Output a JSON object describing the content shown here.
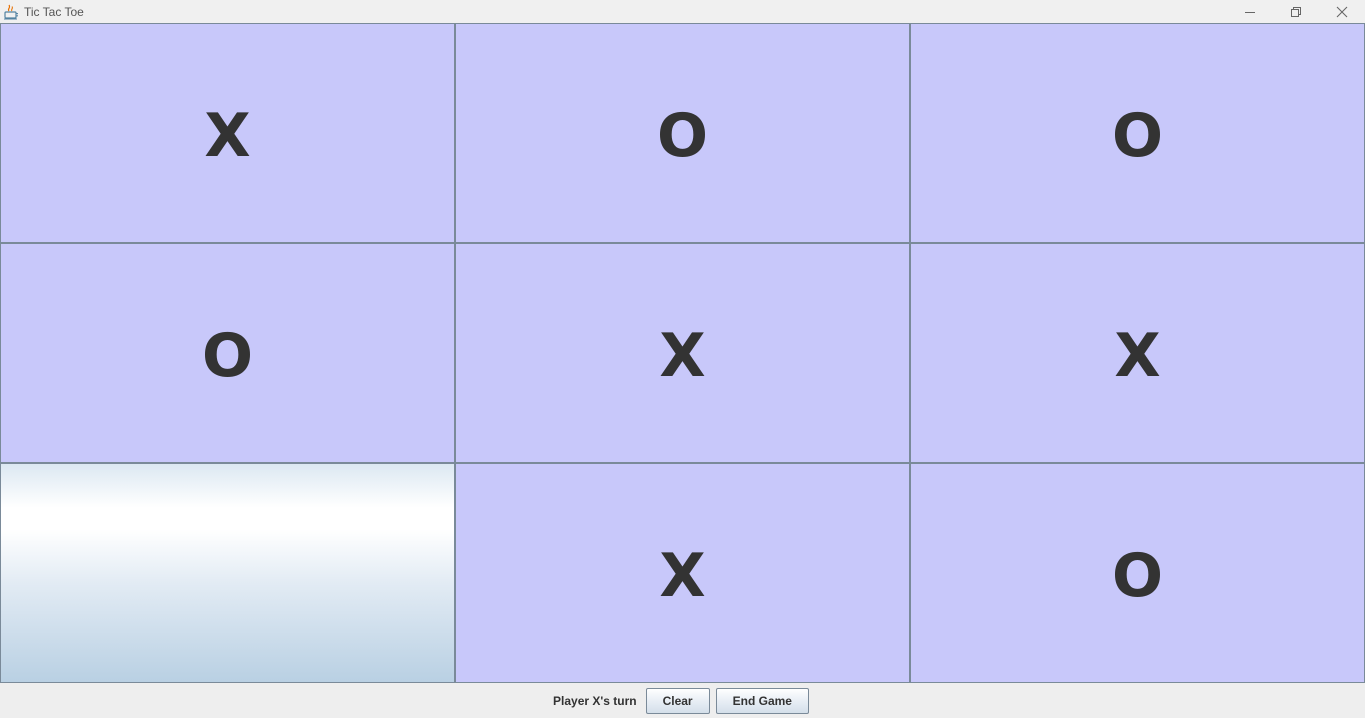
{
  "window": {
    "title": "Tic Tac Toe",
    "icons": {
      "app": "java-icon",
      "minimize": "minimize-icon",
      "maximize": "restore-icon",
      "close": "close-icon"
    }
  },
  "board": {
    "cells": [
      {
        "mark": "X",
        "hovered": false
      },
      {
        "mark": "O",
        "hovered": false
      },
      {
        "mark": "O",
        "hovered": false
      },
      {
        "mark": "O",
        "hovered": false
      },
      {
        "mark": "X",
        "hovered": false
      },
      {
        "mark": "X",
        "hovered": false
      },
      {
        "mark": "",
        "hovered": true
      },
      {
        "mark": "X",
        "hovered": false
      },
      {
        "mark": "O",
        "hovered": false
      }
    ]
  },
  "status": {
    "text": "Player X's turn",
    "clear_label": "Clear",
    "end_label": "End Game"
  },
  "colors": {
    "cell_background": "#c8c8fa",
    "grid_line": "#7a8a99",
    "mark": "#333333"
  }
}
